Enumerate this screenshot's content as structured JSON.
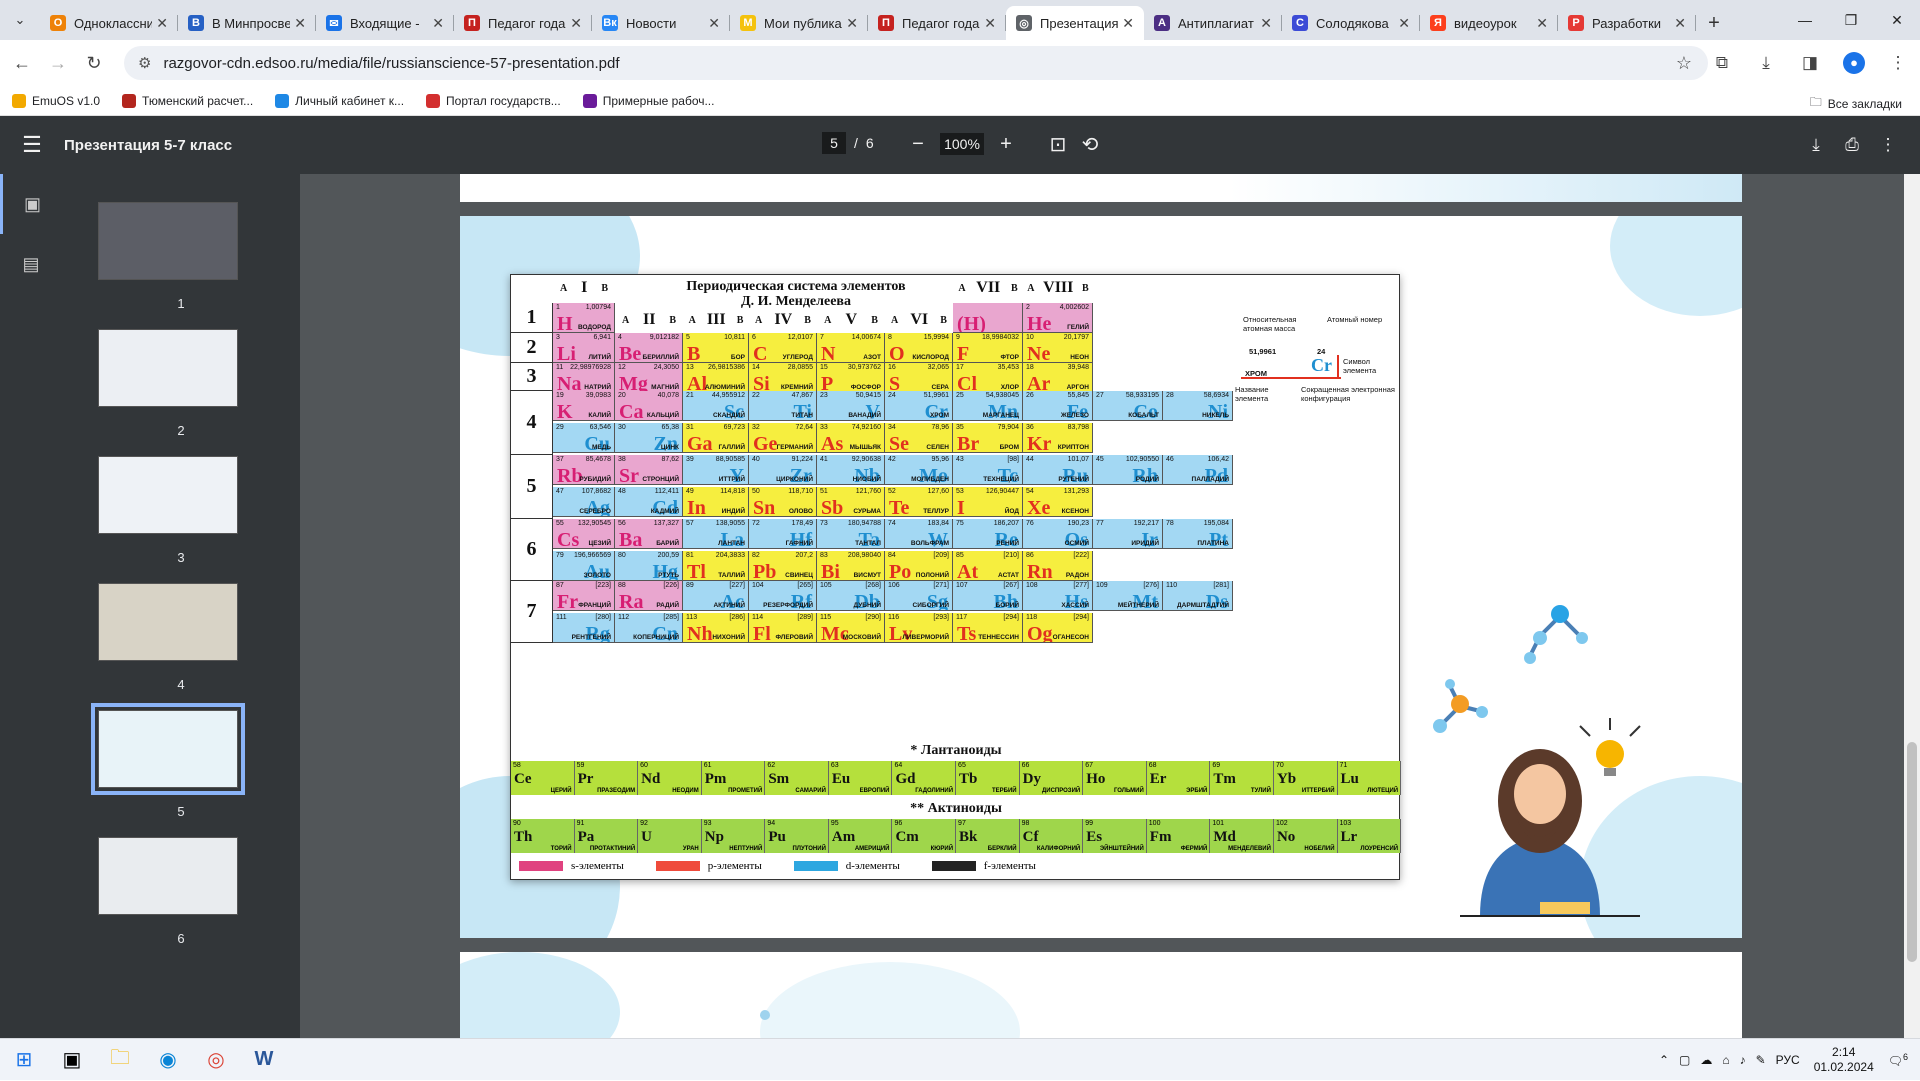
{
  "tabs": [
    {
      "label": "Одноклассники",
      "color": "#ee8208",
      "glyph": "О"
    },
    {
      "label": "В Минпросвещения",
      "color": "#2660c4",
      "glyph": "В"
    },
    {
      "label": "Входящие - ",
      "color": "#1a73e8",
      "glyph": "✉"
    },
    {
      "label": "Педагог года",
      "color": "#c5221f",
      "glyph": "П"
    },
    {
      "label": "Новости",
      "color": "#2787f5",
      "glyph": "Вк"
    },
    {
      "label": "Мои публикации",
      "color": "#f4c20d",
      "glyph": "М"
    },
    {
      "label": "Педагог года",
      "color": "#c5221f",
      "glyph": "П"
    },
    {
      "label": "Презентация",
      "color": "#5f6368",
      "glyph": "◎",
      "active": true
    },
    {
      "label": "Антиплагиат",
      "color": "#4b2e83",
      "glyph": "А"
    },
    {
      "label": "Солодякова",
      "color": "#3c4bd6",
      "glyph": "С"
    },
    {
      "label": "видеоурок",
      "color": "#fc3f1d",
      "glyph": "Я"
    },
    {
      "label": "Разработки",
      "color": "#e53935",
      "glyph": "Р"
    }
  ],
  "address": {
    "url": "razgovor-cdn.edsoo.ru/media/file/russianscience-57-presentation.pdf"
  },
  "bookmarks": [
    {
      "label": "EmuOS v1.0",
      "color": "#f2a900"
    },
    {
      "label": "Тюменский расчет...",
      "color": "#b3261e"
    },
    {
      "label": "Личный кабинет к...",
      "color": "#1e88e5"
    },
    {
      "label": "Портал государств...",
      "color": "#d32f2f"
    },
    {
      "label": "Примерные рабоч...",
      "color": "#6a1b9a"
    }
  ],
  "bookmarks_all": "Все закладки",
  "pdf": {
    "title": "Презентация 5-7 класс",
    "page_current": "5",
    "page_sep": "/",
    "page_total": "6",
    "zoom": "100%"
  },
  "thumbnails": [
    {
      "num": "1",
      "bg": "#5c5e66"
    },
    {
      "num": "2",
      "bg": "#eceff3"
    },
    {
      "num": "3",
      "bg": "#eef2f6"
    },
    {
      "num": "4",
      "bg": "#d8d3c6"
    },
    {
      "num": "5",
      "bg": "#e8f3f8",
      "selected": true
    },
    {
      "num": "6",
      "bg": "#e9ecef"
    }
  ],
  "table": {
    "title_line1": "Периодическая система элементов",
    "title_line2": "Д. И. Менделеева",
    "group_labels": [
      "I",
      "II",
      "III",
      "IV",
      "V",
      "VI",
      "VII",
      "VIII"
    ],
    "sub_a": "A",
    "sub_b": "B",
    "periods": [
      "1",
      "2",
      "3",
      "4",
      "5",
      "6",
      "7"
    ],
    "key": {
      "mass_label": "Относительная атомная масса",
      "number_label": "Атомный номер",
      "symbol_label": "Символ элемента",
      "name_label": "Название элемента",
      "config_label": "Сокращенная электронная конфигурация",
      "example_mass": "51,9961",
      "example_num": "24",
      "example_sym": "Cr",
      "example_name": "ХРОМ"
    },
    "lanthanides_title": "* Лантаноиды",
    "actinides_title": "** Актиноиды",
    "legend": [
      "s-элементы",
      "p-элементы",
      "d-элементы",
      "f-элементы"
    ],
    "legend_colors": [
      "#e0427f",
      "#ef4b3b",
      "#2ea7e0",
      "#222222"
    ]
  },
  "elements": [
    {
      "s": "H",
      "n": "1",
      "m": "1,00794",
      "nm": "ВОДОРОД",
      "t": "s",
      "r": 0,
      "c": 0
    },
    {
      "s": "(H)",
      "n": "",
      "m": "",
      "nm": "",
      "t": "s",
      "r": 0,
      "c": 6
    },
    {
      "s": "He",
      "n": "2",
      "m": "4,002602",
      "nm": "ГЕЛИЙ",
      "t": "s",
      "r": 0,
      "c": 7
    },
    {
      "s": "Li",
      "n": "3",
      "m": "6,941",
      "nm": "ЛИТИЙ",
      "t": "s",
      "r": 1,
      "c": 0
    },
    {
      "s": "Be",
      "n": "4",
      "m": "9,012182",
      "nm": "БЕРИЛЛИЙ",
      "t": "s",
      "r": 1,
      "c": 1
    },
    {
      "s": "B",
      "n": "5",
      "m": "10,811",
      "nm": "БОР",
      "t": "p",
      "r": 1,
      "c": 2
    },
    {
      "s": "C",
      "n": "6",
      "m": "12,0107",
      "nm": "УГЛЕРОД",
      "t": "p",
      "r": 1,
      "c": 3
    },
    {
      "s": "N",
      "n": "7",
      "m": "14,00674",
      "nm": "АЗОТ",
      "t": "p",
      "r": 1,
      "c": 4
    },
    {
      "s": "O",
      "n": "8",
      "m": "15,9994",
      "nm": "КИСЛОРОД",
      "t": "p",
      "r": 1,
      "c": 5
    },
    {
      "s": "F",
      "n": "9",
      "m": "18,9984032",
      "nm": "ФТОР",
      "t": "p",
      "r": 1,
      "c": 6
    },
    {
      "s": "Ne",
      "n": "10",
      "m": "20,1797",
      "nm": "НЕОН",
      "t": "p",
      "r": 1,
      "c": 7
    },
    {
      "s": "Na",
      "n": "11",
      "m": "22,98976928",
      "nm": "НАТРИЙ",
      "t": "s",
      "r": 2,
      "c": 0
    },
    {
      "s": "Mg",
      "n": "12",
      "m": "24,3050",
      "nm": "МАГНИЙ",
      "t": "s",
      "r": 2,
      "c": 1
    },
    {
      "s": "Al",
      "n": "13",
      "m": "26,9815386",
      "nm": "АЛЮМИНИЙ",
      "t": "p",
      "r": 2,
      "c": 2
    },
    {
      "s": "Si",
      "n": "14",
      "m": "28,0855",
      "nm": "КРЕМНИЙ",
      "t": "p",
      "r": 2,
      "c": 3
    },
    {
      "s": "P",
      "n": "15",
      "m": "30,973762",
      "nm": "ФОСФОР",
      "t": "p",
      "r": 2,
      "c": 4
    },
    {
      "s": "S",
      "n": "16",
      "m": "32,065",
      "nm": "СЕРА",
      "t": "p",
      "r": 2,
      "c": 5
    },
    {
      "s": "Cl",
      "n": "17",
      "m": "35,453",
      "nm": "ХЛОР",
      "t": "p",
      "r": 2,
      "c": 6
    },
    {
      "s": "Ar",
      "n": "18",
      "m": "39,948",
      "nm": "АРГОН",
      "t": "p",
      "r": 2,
      "c": 7
    },
    {
      "s": "K",
      "n": "19",
      "m": "39,0983",
      "nm": "КАЛИЙ",
      "t": "s",
      "r": 3,
      "c": 0
    },
    {
      "s": "Ca",
      "n": "20",
      "m": "40,078",
      "nm": "КАЛЬЦИЙ",
      "t": "s",
      "r": 3,
      "c": 1
    },
    {
      "s": "Sc",
      "n": "21",
      "m": "44,955912",
      "nm": "СКАНДИЙ",
      "t": "d",
      "r": 3,
      "c": 2
    },
    {
      "s": "Ti",
      "n": "22",
      "m": "47,867",
      "nm": "ТИТАН",
      "t": "d",
      "r": 3,
      "c": 3
    },
    {
      "s": "V",
      "n": "23",
      "m": "50,9415",
      "nm": "ВАНАДИЙ",
      "t": "d",
      "r": 3,
      "c": 4
    },
    {
      "s": "Cr",
      "n": "24",
      "m": "51,9961",
      "nm": "ХРОМ",
      "t": "d",
      "r": 3,
      "c": 5
    },
    {
      "s": "Mn",
      "n": "25",
      "m": "54,938045",
      "nm": "МАРГАНЕЦ",
      "t": "d",
      "r": 3,
      "c": 6
    },
    {
      "s": "Fe",
      "n": "26",
      "m": "55,845",
      "nm": "ЖЕЛЕЗО",
      "t": "d",
      "r": 3,
      "c": 7
    },
    {
      "s": "Co",
      "n": "27",
      "m": "58,933195",
      "nm": "КОБАЛЬТ",
      "t": "d",
      "r": 3,
      "c": 8
    },
    {
      "s": "Ni",
      "n": "28",
      "m": "58,6934",
      "nm": "НИКЕЛЬ",
      "t": "d",
      "r": 3,
      "c": 9
    },
    {
      "s": "Cu",
      "n": "29",
      "m": "63,546",
      "nm": "МЕДЬ",
      "t": "d",
      "r": 4,
      "c": 0
    },
    {
      "s": "Zn",
      "n": "30",
      "m": "65,38",
      "nm": "ЦИНК",
      "t": "d",
      "r": 4,
      "c": 1
    },
    {
      "s": "Ga",
      "n": "31",
      "m": "69,723",
      "nm": "ГАЛЛИЙ",
      "t": "p",
      "r": 4,
      "c": 2
    },
    {
      "s": "Ge",
      "n": "32",
      "m": "72,64",
      "nm": "ГЕРМАНИЙ",
      "t": "p",
      "r": 4,
      "c": 3
    },
    {
      "s": "As",
      "n": "33",
      "m": "74,92160",
      "nm": "МЫШЬЯК",
      "t": "p",
      "r": 4,
      "c": 4
    },
    {
      "s": "Se",
      "n": "34",
      "m": "78,96",
      "nm": "СЕЛЕН",
      "t": "p",
      "r": 4,
      "c": 5
    },
    {
      "s": "Br",
      "n": "35",
      "m": "79,904",
      "nm": "БРОМ",
      "t": "p",
      "r": 4,
      "c": 6
    },
    {
      "s": "Kr",
      "n": "36",
      "m": "83,798",
      "nm": "КРИПТОН",
      "t": "p",
      "r": 4,
      "c": 7
    },
    {
      "s": "Rb",
      "n": "37",
      "m": "85,4678",
      "nm": "РУБИДИЙ",
      "t": "s",
      "r": 5,
      "c": 0
    },
    {
      "s": "Sr",
      "n": "38",
      "m": "87,62",
      "nm": "СТРОНЦИЙ",
      "t": "s",
      "r": 5,
      "c": 1
    },
    {
      "s": "Y",
      "n": "39",
      "m": "88,90585",
      "nm": "ИТТРИЙ",
      "t": "d",
      "r": 5,
      "c": 2
    },
    {
      "s": "Zr",
      "n": "40",
      "m": "91,224",
      "nm": "ЦИРКОНИЙ",
      "t": "d",
      "r": 5,
      "c": 3
    },
    {
      "s": "Nb",
      "n": "41",
      "m": "92,90638",
      "nm": "НИОБИЙ",
      "t": "d",
      "r": 5,
      "c": 4
    },
    {
      "s": "Mo",
      "n": "42",
      "m": "95,96",
      "nm": "МОЛИБДЕН",
      "t": "d",
      "r": 5,
      "c": 5
    },
    {
      "s": "Tc",
      "n": "43",
      "m": "[98]",
      "nm": "ТЕХНЕЦИЙ",
      "t": "d",
      "r": 5,
      "c": 6
    },
    {
      "s": "Ru",
      "n": "44",
      "m": "101,07",
      "nm": "РУТЕНИЙ",
      "t": "d",
      "r": 5,
      "c": 7
    },
    {
      "s": "Rh",
      "n": "45",
      "m": "102,90550",
      "nm": "РОДИЙ",
      "t": "d",
      "r": 5,
      "c": 8
    },
    {
      "s": "Pd",
      "n": "46",
      "m": "106,42",
      "nm": "ПАЛЛАДИЙ",
      "t": "d",
      "r": 5,
      "c": 9
    },
    {
      "s": "Ag",
      "n": "47",
      "m": "107,8682",
      "nm": "СЕРЕБРО",
      "t": "d",
      "r": 6,
      "c": 0
    },
    {
      "s": "Cd",
      "n": "48",
      "m": "112,411",
      "nm": "КАДМИЙ",
      "t": "d",
      "r": 6,
      "c": 1
    },
    {
      "s": "In",
      "n": "49",
      "m": "114,818",
      "nm": "ИНДИЙ",
      "t": "p",
      "r": 6,
      "c": 2
    },
    {
      "s": "Sn",
      "n": "50",
      "m": "118,710",
      "nm": "ОЛОВО",
      "t": "p",
      "r": 6,
      "c": 3
    },
    {
      "s": "Sb",
      "n": "51",
      "m": "121,760",
      "nm": "СУРЬМА",
      "t": "p",
      "r": 6,
      "c": 4
    },
    {
      "s": "Te",
      "n": "52",
      "m": "127,60",
      "nm": "ТЕЛЛУР",
      "t": "p",
      "r": 6,
      "c": 5
    },
    {
      "s": "I",
      "n": "53",
      "m": "126,90447",
      "nm": "ЙОД",
      "t": "p",
      "r": 6,
      "c": 6
    },
    {
      "s": "Xe",
      "n": "54",
      "m": "131,293",
      "nm": "КСЕНОН",
      "t": "p",
      "r": 6,
      "c": 7
    },
    {
      "s": "Cs",
      "n": "55",
      "m": "132,90545",
      "nm": "ЦЕЗИЙ",
      "t": "s",
      "r": 7,
      "c": 0
    },
    {
      "s": "Ba",
      "n": "56",
      "m": "137,327",
      "nm": "БАРИЙ",
      "t": "s",
      "r": 7,
      "c": 1
    },
    {
      "s": "La",
      "n": "57",
      "m": "138,9055",
      "nm": "ЛАНТАН",
      "t": "d",
      "r": 7,
      "c": 2
    },
    {
      "s": "Hf",
      "n": "72",
      "m": "178,49",
      "nm": "ГАФНИЙ",
      "t": "d",
      "r": 7,
      "c": 3
    },
    {
      "s": "Ta",
      "n": "73",
      "m": "180,94788",
      "nm": "ТАНТАЛ",
      "t": "d",
      "r": 7,
      "c": 4
    },
    {
      "s": "W",
      "n": "74",
      "m": "183,84",
      "nm": "ВОЛЬФРАМ",
      "t": "d",
      "r": 7,
      "c": 5
    },
    {
      "s": "Re",
      "n": "75",
      "m": "186,207",
      "nm": "РЕНИЙ",
      "t": "d",
      "r": 7,
      "c": 6
    },
    {
      "s": "Os",
      "n": "76",
      "m": "190,23",
      "nm": "ОСМИЙ",
      "t": "d",
      "r": 7,
      "c": 7
    },
    {
      "s": "Ir",
      "n": "77",
      "m": "192,217",
      "nm": "ИРИДИЙ",
      "t": "d",
      "r": 7,
      "c": 8
    },
    {
      "s": "Pt",
      "n": "78",
      "m": "195,084",
      "nm": "ПЛАТИНА",
      "t": "d",
      "r": 7,
      "c": 9
    },
    {
      "s": "Au",
      "n": "79",
      "m": "196,966569",
      "nm": "ЗОЛОТО",
      "t": "d",
      "r": 8,
      "c": 0
    },
    {
      "s": "Hg",
      "n": "80",
      "m": "200,59",
      "nm": "РТУТЬ",
      "t": "d",
      "r": 8,
      "c": 1
    },
    {
      "s": "Tl",
      "n": "81",
      "m": "204,3833",
      "nm": "ТАЛЛИЙ",
      "t": "p",
      "r": 8,
      "c": 2
    },
    {
      "s": "Pb",
      "n": "82",
      "m": "207,2",
      "nm": "СВИНЕЦ",
      "t": "p",
      "r": 8,
      "c": 3
    },
    {
      "s": "Bi",
      "n": "83",
      "m": "208,98040",
      "nm": "ВИСМУТ",
      "t": "p",
      "r": 8,
      "c": 4
    },
    {
      "s": "Po",
      "n": "84",
      "m": "[209]",
      "nm": "ПОЛОНИЙ",
      "t": "p",
      "r": 8,
      "c": 5
    },
    {
      "s": "At",
      "n": "85",
      "m": "[210]",
      "nm": "АСТАТ",
      "t": "p",
      "r": 8,
      "c": 6
    },
    {
      "s": "Rn",
      "n": "86",
      "m": "[222]",
      "nm": "РАДОН",
      "t": "p",
      "r": 8,
      "c": 7
    },
    {
      "s": "Fr",
      "n": "87",
      "m": "[223]",
      "nm": "ФРАНЦИЙ",
      "t": "s",
      "r": 9,
      "c": 0
    },
    {
      "s": "Ra",
      "n": "88",
      "m": "[226]",
      "nm": "РАДИЙ",
      "t": "s",
      "r": 9,
      "c": 1
    },
    {
      "s": "Ac",
      "n": "89",
      "m": "[227]",
      "nm": "АКТИНИЙ",
      "t": "d",
      "r": 9,
      "c": 2
    },
    {
      "s": "Rf",
      "n": "104",
      "m": "[265]",
      "nm": "РЕЗЕРФОРДИЙ",
      "t": "d",
      "r": 9,
      "c": 3
    },
    {
      "s": "Db",
      "n": "105",
      "m": "[268]",
      "nm": "ДУБНИЙ",
      "t": "d",
      "r": 9,
      "c": 4
    },
    {
      "s": "Sg",
      "n": "106",
      "m": "[271]",
      "nm": "СИБОРГИЙ",
      "t": "d",
      "r": 9,
      "c": 5
    },
    {
      "s": "Bh",
      "n": "107",
      "m": "[267]",
      "nm": "БОРИЙ",
      "t": "d",
      "r": 9,
      "c": 6
    },
    {
      "s": "Hs",
      "n": "108",
      "m": "[277]",
      "nm": "ХАССИЙ",
      "t": "d",
      "r": 9,
      "c": 7
    },
    {
      "s": "Mt",
      "n": "109",
      "m": "[276]",
      "nm": "МЕЙТНЕРИЙ",
      "t": "d",
      "r": 9,
      "c": 8
    },
    {
      "s": "Ds",
      "n": "110",
      "m": "[281]",
      "nm": "ДАРМШТАДТИЙ",
      "t": "d",
      "r": 9,
      "c": 9
    },
    {
      "s": "Rg",
      "n": "111",
      "m": "[280]",
      "nm": "РЕНТГЕНИЙ",
      "t": "d",
      "r": 10,
      "c": 0
    },
    {
      "s": "Cn",
      "n": "112",
      "m": "[285]",
      "nm": "КОПЕРНИЦИЙ",
      "t": "d",
      "r": 10,
      "c": 1
    },
    {
      "s": "Nh",
      "n": "113",
      "m": "[286]",
      "nm": "НИХОНИЙ",
      "t": "p",
      "r": 10,
      "c": 2
    },
    {
      "s": "Fl",
      "n": "114",
      "m": "[289]",
      "nm": "ФЛЕРОВИЙ",
      "t": "p",
      "r": 10,
      "c": 3
    },
    {
      "s": "Mc",
      "n": "115",
      "m": "[290]",
      "nm": "МОСКОВИЙ",
      "t": "p",
      "r": 10,
      "c": 4
    },
    {
      "s": "Lv",
      "n": "116",
      "m": "[293]",
      "nm": "ЛИВЕРМОРИЙ",
      "t": "p",
      "r": 10,
      "c": 5
    },
    {
      "s": "Ts",
      "n": "117",
      "m": "[294]",
      "nm": "ТЕННЕССИН",
      "t": "p",
      "r": 10,
      "c": 6
    },
    {
      "s": "Og",
      "n": "118",
      "m": "[294]",
      "nm": "ОГАНЕСОН",
      "t": "p",
      "r": 10,
      "c": 7
    }
  ],
  "lanthanides": [
    {
      "s": "Ce",
      "n": "58",
      "nm": "ЦЕРИЙ"
    },
    {
      "s": "Pr",
      "n": "59",
      "nm": "ПРАЗЕОДИМ"
    },
    {
      "s": "Nd",
      "n": "60",
      "nm": "НЕОДИМ"
    },
    {
      "s": "Pm",
      "n": "61",
      "nm": "ПРОМЕТИЙ"
    },
    {
      "s": "Sm",
      "n": "62",
      "nm": "САМАРИЙ"
    },
    {
      "s": "Eu",
      "n": "63",
      "nm": "ЕВРОПИЙ"
    },
    {
      "s": "Gd",
      "n": "64",
      "nm": "ГАДОЛИНИЙ"
    },
    {
      "s": "Tb",
      "n": "65",
      "nm": "ТЕРБИЙ"
    },
    {
      "s": "Dy",
      "n": "66",
      "nm": "ДИСПРОЗИЙ"
    },
    {
      "s": "Ho",
      "n": "67",
      "nm": "ГОЛЬМИЙ"
    },
    {
      "s": "Er",
      "n": "68",
      "nm": "ЭРБИЙ"
    },
    {
      "s": "Tm",
      "n": "69",
      "nm": "ТУЛИЙ"
    },
    {
      "s": "Yb",
      "n": "70",
      "nm": "ИТТЕРБИЙ"
    },
    {
      "s": "Lu",
      "n": "71",
      "nm": "ЛЮТЕЦИЙ"
    }
  ],
  "actinides": [
    {
      "s": "Th",
      "n": "90",
      "nm": "ТОРИЙ"
    },
    {
      "s": "Pa",
      "n": "91",
      "nm": "ПРОТАКТИНИЙ"
    },
    {
      "s": "U",
      "n": "92",
      "nm": "УРАН"
    },
    {
      "s": "Np",
      "n": "93",
      "nm": "НЕПТУНИЙ"
    },
    {
      "s": "Pu",
      "n": "94",
      "nm": "ПЛУТОНИЙ"
    },
    {
      "s": "Am",
      "n": "95",
      "nm": "АМЕРИЦИЙ"
    },
    {
      "s": "Cm",
      "n": "96",
      "nm": "КЮРИЙ"
    },
    {
      "s": "Bk",
      "n": "97",
      "nm": "БЕРКЛИЙ"
    },
    {
      "s": "Cf",
      "n": "98",
      "nm": "КАЛИФОРНИЙ"
    },
    {
      "s": "Es",
      "n": "99",
      "nm": "ЭЙНШТЕЙНИЙ"
    },
    {
      "s": "Fm",
      "n": "100",
      "nm": "ФЕРМИЙ"
    },
    {
      "s": "Md",
      "n": "101",
      "nm": "МЕНДЕЛЕВИЙ"
    },
    {
      "s": "No",
      "n": "102",
      "nm": "НОБЕЛИЙ"
    },
    {
      "s": "Lr",
      "n": "103",
      "nm": "ЛОУРЕНСИЙ"
    }
  ],
  "taskbar": {
    "lang": "РУС",
    "time": "2:14",
    "date": "01.02.2024",
    "notif_count": "6"
  }
}
